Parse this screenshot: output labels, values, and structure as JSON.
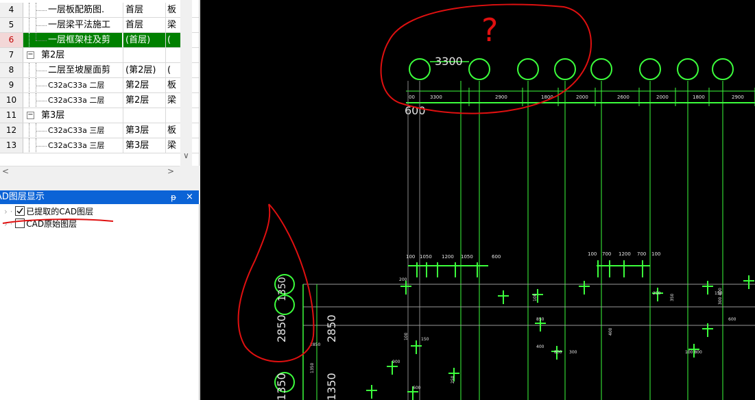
{
  "floor_table": {
    "rows": [
      {
        "num": "4",
        "name": "一层板配筋图.",
        "floor": "首层",
        "extra": "板",
        "indent": 2
      },
      {
        "num": "5",
        "name": "一层梁平法施工",
        "floor": "首层",
        "extra": "梁",
        "indent": 2
      },
      {
        "num": "6",
        "name": "一层框架柱及剪",
        "floor": "(首层)",
        "extra": "(",
        "indent": 2,
        "selected": true
      },
      {
        "num": "7",
        "name": "第2层",
        "floor": "",
        "extra": "",
        "indent": 1,
        "group": true
      },
      {
        "num": "8",
        "name": "二层至坡屋面剪",
        "floor": "(第2层)",
        "extra": "(",
        "indent": 2
      },
      {
        "num": "9",
        "name": "C32aC33a 二层",
        "floor": "第2层",
        "extra": "板",
        "indent": 2
      },
      {
        "num": "10",
        "name": "C32aC33a 二层",
        "floor": "第2层",
        "extra": "梁",
        "indent": 2
      },
      {
        "num": "11",
        "name": "第3层",
        "floor": "",
        "extra": "",
        "indent": 1,
        "group": true
      },
      {
        "num": "12",
        "name": "C32aC33a 三层",
        "floor": "第3层",
        "extra": "板",
        "indent": 2
      },
      {
        "num": "13",
        "name": "C32aC33a 三层",
        "floor": "第3层",
        "extra": "梁",
        "indent": 2
      }
    ],
    "expand_symbol": "−",
    "scroll_left": "<",
    "scroll_right": ">",
    "scroll_down": "∨"
  },
  "layer_panel": {
    "title": "AD图层显示",
    "pin": "ᵽ",
    "close": "×",
    "layers": [
      {
        "label": "已提取的CAD图层",
        "checked": true
      },
      {
        "label": "CAD原始图层",
        "checked": false
      }
    ]
  },
  "cad_canvas": {
    "top_dims": [
      "3300",
      "2900",
      "1800",
      "2000",
      "2600",
      "2000",
      "1800",
      "2900"
    ],
    "top_big_label": "3300",
    "top_600": "600",
    "top_left_dim": "00",
    "mid_dims_left": [
      "100",
      "1050",
      "1200",
      "1050",
      "600"
    ],
    "mid_dims_right": [
      "100",
      "700",
      "1200",
      "700",
      "100"
    ],
    "left_big_dims": [
      "1350",
      "2850",
      "1350",
      "2850",
      "1350"
    ],
    "misc_labels": [
      "900",
      "100",
      "150",
      "600",
      "250",
      "400",
      "850",
      "100",
      "800",
      "300",
      "350",
      "150",
      "600",
      "400",
      "200",
      "250",
      "1350",
      "2850",
      "100 800",
      "300 400"
    ],
    "question_mark": "?",
    "colors": {
      "lines": "#3cff3c",
      "grey_lines": "#9a9a9a",
      "dim_text": "#e6e6e6",
      "annotation": "#e01010"
    }
  }
}
